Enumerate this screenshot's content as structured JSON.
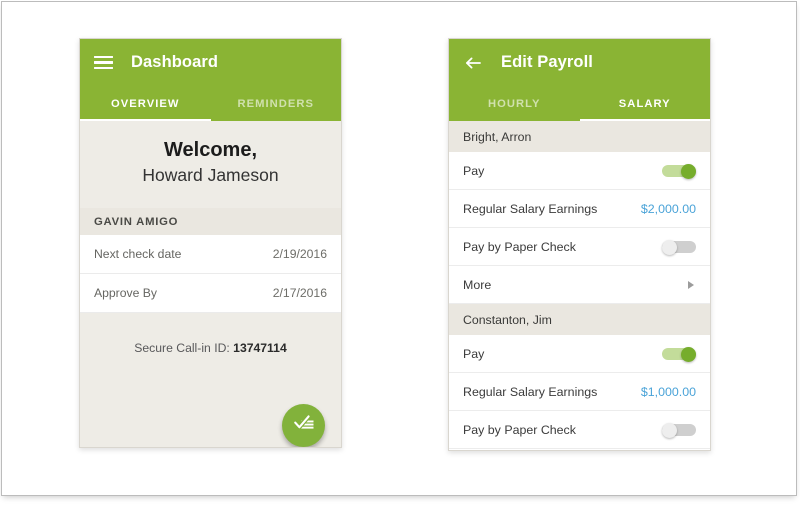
{
  "dashboard": {
    "menu_icon": "hamburger-icon",
    "title": "Dashboard",
    "tabs": [
      {
        "label": "OVERVIEW",
        "active": true
      },
      {
        "label": "REMINDERS",
        "active": false
      }
    ],
    "welcome_line1": "Welcome,",
    "welcome_line2": "Howard Jameson",
    "section_header": "GAVIN AMIGO",
    "rows": [
      {
        "label": "Next check date",
        "value": "2/19/2016"
      },
      {
        "label": "Approve By",
        "value": "2/17/2016"
      }
    ],
    "callin_label": "Secure Call-in ID:",
    "callin_value": "13747114",
    "fab_icon": "approve-check-icon"
  },
  "payroll": {
    "back_icon": "back-arrow-icon",
    "title": "Edit Payroll",
    "tabs": [
      {
        "label": "HOURLY",
        "active": false
      },
      {
        "label": "SALARY",
        "active": true
      }
    ],
    "employees": [
      {
        "name": "Bright, Arron",
        "rows": [
          {
            "type": "toggle",
            "label": "Pay",
            "state": "on"
          },
          {
            "type": "amount",
            "label": "Regular Salary Earnings",
            "value": "$2,000.00"
          },
          {
            "type": "toggle",
            "label": "Pay by Paper Check",
            "state": "off"
          },
          {
            "type": "more",
            "label": "More"
          }
        ]
      },
      {
        "name": "Constanton, Jim",
        "rows": [
          {
            "type": "toggle",
            "label": "Pay",
            "state": "on"
          },
          {
            "type": "amount",
            "label": "Regular Salary Earnings",
            "value": "$1,000.00"
          },
          {
            "type": "toggle",
            "label": "Pay by Paper Check",
            "state": "off"
          }
        ]
      }
    ]
  },
  "colors": {
    "brand_green": "#8ab434",
    "amount_blue": "#4aa3d8",
    "panel_beige": "#eeece6",
    "section_beige": "#eae7e0",
    "toggle_on": "#76ad2c"
  }
}
